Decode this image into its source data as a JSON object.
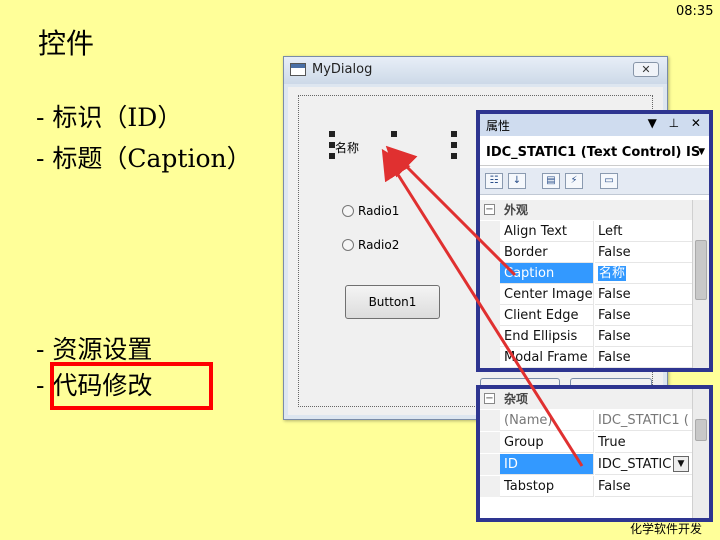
{
  "time": "08:35",
  "slide": {
    "title": "控件",
    "bullets": [
      "- 标识（ID）",
      "- 标题（Caption）",
      "- 资源设置",
      "- 代码修改"
    ]
  },
  "dialog": {
    "title": "MyDialog",
    "close_label": "✕",
    "static_text": "名称",
    "radio1": "Radio1",
    "radio2": "Radio2",
    "button1": "Button1"
  },
  "properties": {
    "title": "属性",
    "header_icons": "▼ ⊥ ✕",
    "selected_object": "IDC_STATIC1 (Text Control) IS",
    "section_appearance": "外观",
    "rows": [
      {
        "name": "Align Text",
        "value": "Left"
      },
      {
        "name": "Border",
        "value": "False"
      },
      {
        "name": "Caption",
        "value": "名称"
      },
      {
        "name": "Center Image",
        "value": "False"
      },
      {
        "name": "Client Edge",
        "value": "False"
      },
      {
        "name": "End Ellipsis",
        "value": "False"
      },
      {
        "name": "Modal Frame",
        "value": "False"
      }
    ],
    "section_misc": "杂项",
    "misc_rows": [
      {
        "name": "(Name)",
        "value": "IDC_STATIC1 ("
      },
      {
        "name": "Group",
        "value": "True"
      },
      {
        "name": "ID",
        "value": "IDC_STATIC"
      },
      {
        "name": "Tabstop",
        "value": "False"
      }
    ]
  },
  "footer": "化学软件开发",
  "colors": {
    "highlight_box": "#ff0000",
    "panel_border": "#2e3590",
    "selection": "#3399ff",
    "background": "#ffff99"
  }
}
